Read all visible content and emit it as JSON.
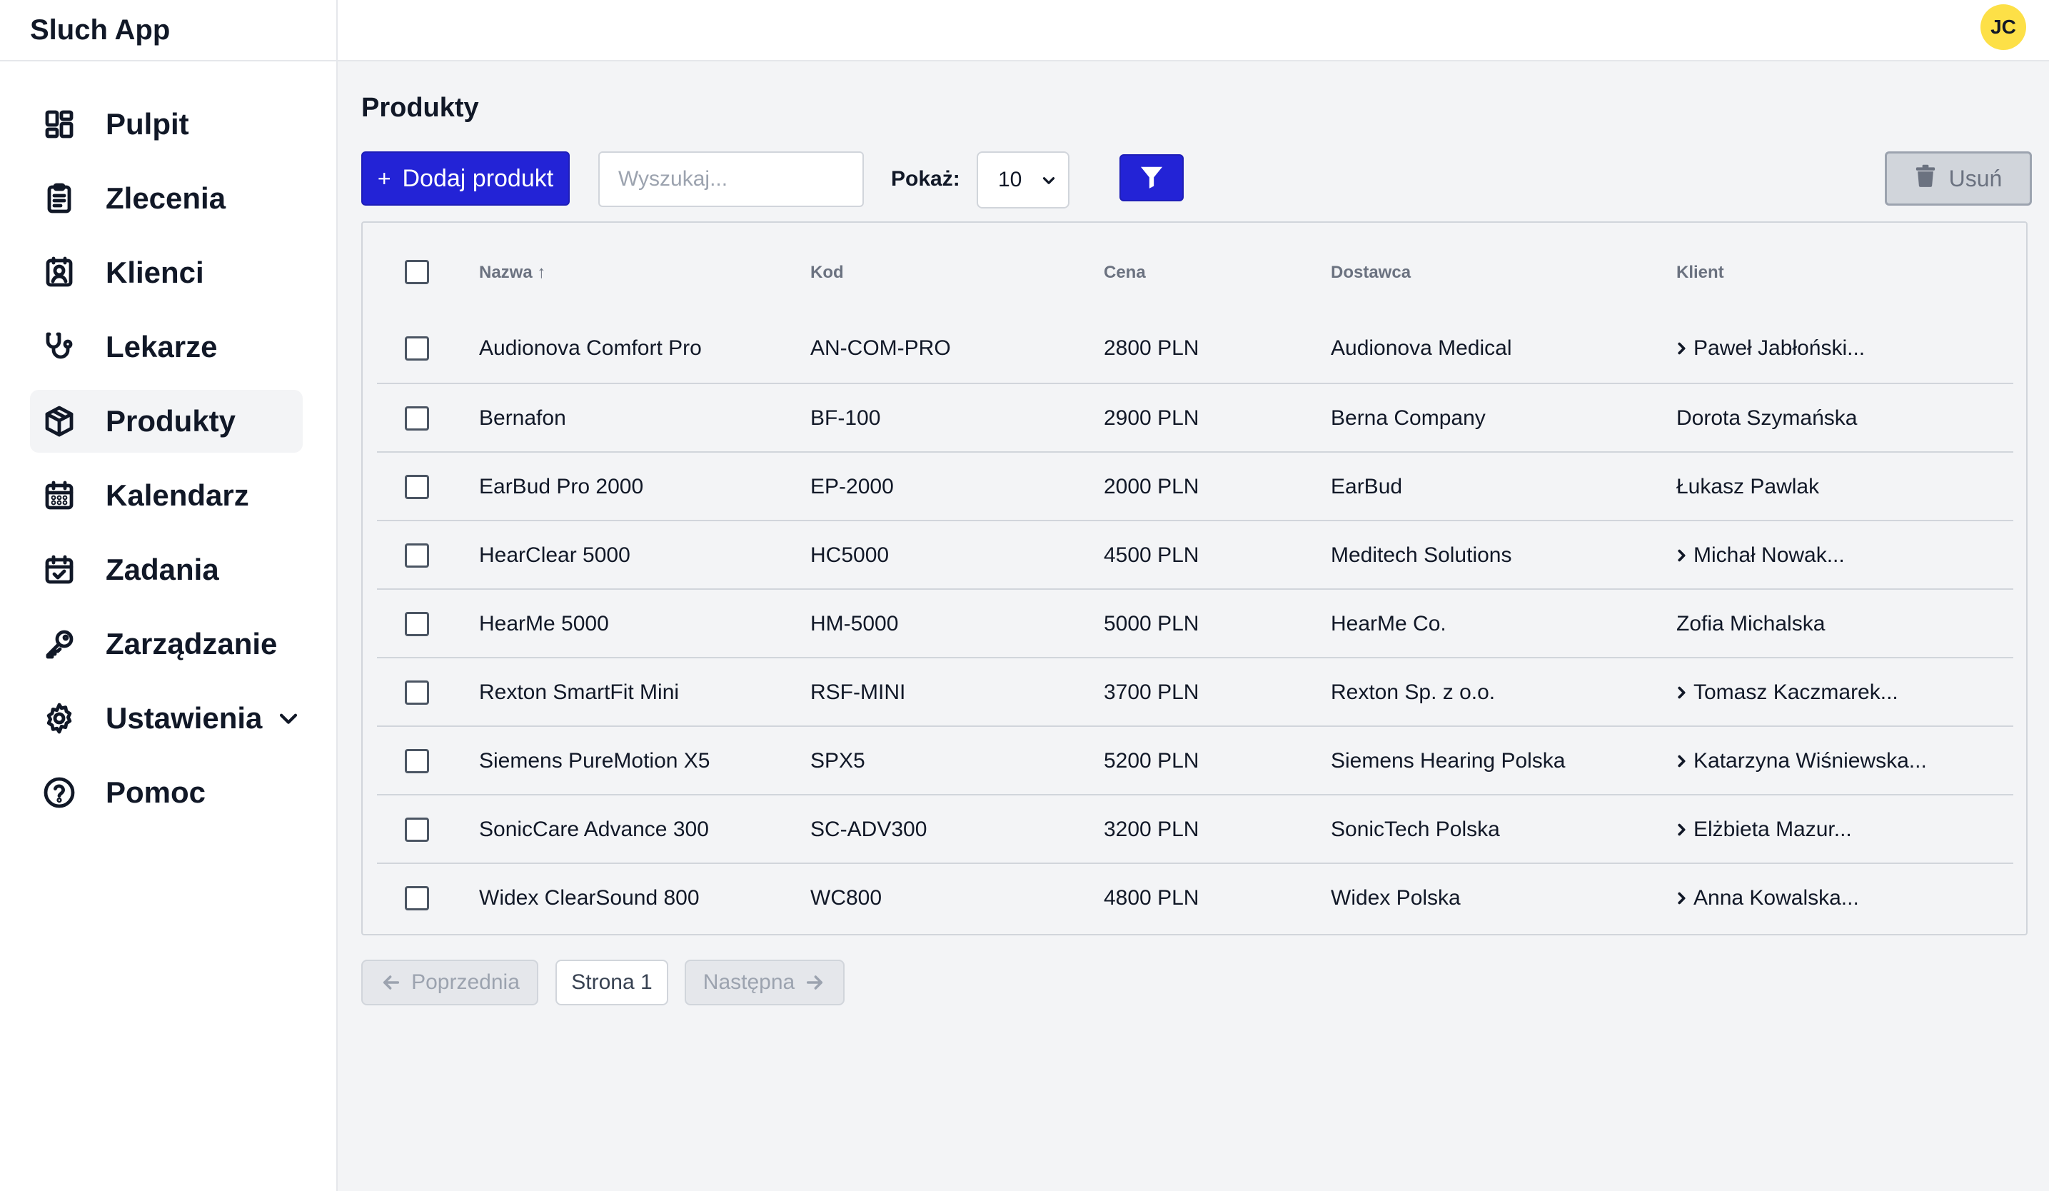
{
  "app": {
    "title": "Sluch App",
    "user_initials": "JC"
  },
  "sidebar": {
    "items": [
      {
        "label": "Pulpit",
        "icon": "dashboard-icon"
      },
      {
        "label": "Zlecenia",
        "icon": "clipboard-icon"
      },
      {
        "label": "Klienci",
        "icon": "contact-icon"
      },
      {
        "label": "Lekarze",
        "icon": "stethoscope-icon"
      },
      {
        "label": "Produkty",
        "icon": "box-icon",
        "active": true
      },
      {
        "label": "Kalendarz",
        "icon": "calendar-icon"
      },
      {
        "label": "Zadania",
        "icon": "calendar-check-icon"
      },
      {
        "label": "Zarządzanie",
        "icon": "key-icon"
      },
      {
        "label": "Ustawienia",
        "icon": "gear-icon",
        "has_chevron": true
      },
      {
        "label": "Pomoc",
        "icon": "help-icon"
      }
    ]
  },
  "page": {
    "title": "Produkty",
    "add_button": "Dodaj produkt",
    "add_button_icon": "+",
    "search_placeholder": "Wyszukaj...",
    "show_label": "Pokaż:",
    "page_size": "10",
    "delete_button": "Usuń"
  },
  "table": {
    "columns": [
      "Nazwa ↑",
      "Kod",
      "Cena",
      "Dostawca",
      "Klient"
    ],
    "rows": [
      {
        "name": "Audionova Comfort Pro",
        "code": "AN-COM-PRO",
        "price": "2800 PLN",
        "supplier": "Audionova Medical",
        "client": "Paweł Jabłoński...",
        "client_link": true
      },
      {
        "name": "Bernafon",
        "code": "BF-100",
        "price": "2900 PLN",
        "supplier": "Berna Company",
        "client": "Dorota Szymańska",
        "client_link": false
      },
      {
        "name": "EarBud Pro 2000",
        "code": "EP-2000",
        "price": "2000 PLN",
        "supplier": "EarBud",
        "client": "Łukasz Pawlak",
        "client_link": false
      },
      {
        "name": "HearClear 5000",
        "code": "HC5000",
        "price": "4500 PLN",
        "supplier": "Meditech Solutions",
        "client": "Michał Nowak...",
        "client_link": true
      },
      {
        "name": "HearMe 5000",
        "code": "HM-5000",
        "price": "5000 PLN",
        "supplier": "HearMe Co.",
        "client": "Zofia Michalska",
        "client_link": false
      },
      {
        "name": "Rexton SmartFit Mini",
        "code": "RSF-MINI",
        "price": "3700 PLN",
        "supplier": "Rexton Sp. z o.o.",
        "client": "Tomasz Kaczmarek...",
        "client_link": true
      },
      {
        "name": "Siemens PureMotion X5",
        "code": "SPX5",
        "price": "5200 PLN",
        "supplier": "Siemens Hearing Polska",
        "client": "Katarzyna Wiśniewska...",
        "client_link": true
      },
      {
        "name": "SonicCare Advance 300",
        "code": "SC-ADV300",
        "price": "3200 PLN",
        "supplier": "SonicTech Polska",
        "client": "Elżbieta Mazur...",
        "client_link": true
      },
      {
        "name": "Widex ClearSound 800",
        "code": "WC800",
        "price": "4800 PLN",
        "supplier": "Widex Polska",
        "client": "Anna Kowalska...",
        "client_link": true
      }
    ]
  },
  "pagination": {
    "prev": "Poprzednia",
    "current": "Strona 1",
    "next": "Następna"
  },
  "colors": {
    "primary": "#2323d6",
    "avatar": "#fde047",
    "background": "#f3f4f6"
  }
}
